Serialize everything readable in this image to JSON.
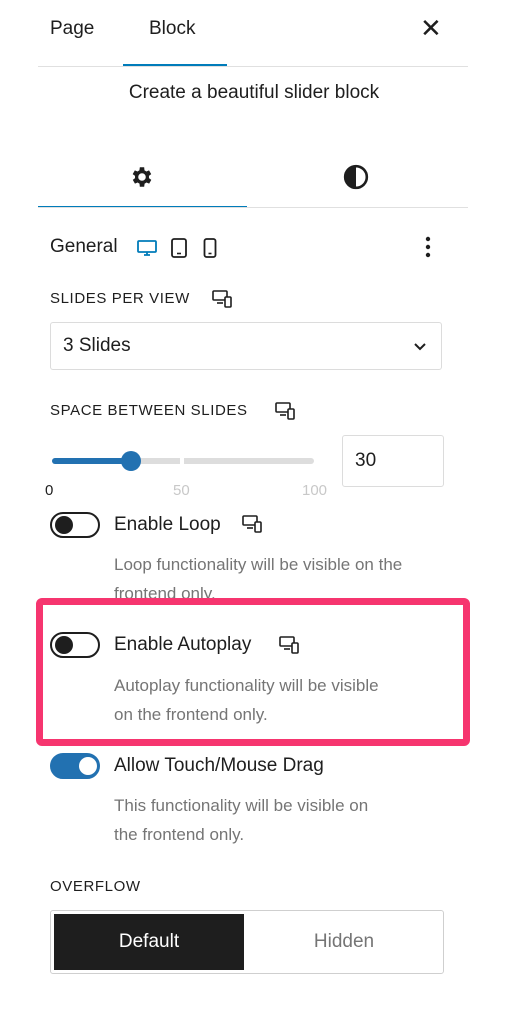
{
  "header": {
    "tabs": [
      "Page",
      "Block"
    ],
    "close_glyph": "✕",
    "icons": {
      "close": "close-icon"
    }
  },
  "block": {
    "description": "Create a beautiful slider block",
    "settings_tabs": [
      {
        "icon": "gear-icon"
      },
      {
        "icon": "contrast-icon"
      }
    ]
  },
  "general": {
    "title": "General",
    "devices": [
      "desktop-icon",
      "tablet-icon",
      "mobile-icon"
    ],
    "menu_icon": "more-vertical-icon"
  },
  "slides_per_view": {
    "label": "SLIDES PER VIEW",
    "value": "3 Slides"
  },
  "space_between": {
    "label": "SPACE BETWEEN SLIDES",
    "value": "30",
    "min": "0",
    "mid": "50",
    "max": "100",
    "fraction": 0.3
  },
  "loop": {
    "label": "Enable Loop",
    "enabled": false,
    "help": "Loop functionality will be visible on the frontend only."
  },
  "autoplay": {
    "label": "Enable Autoplay",
    "enabled": false,
    "help_line1": "Autoplay functionality will be visible",
    "help_line2": "on the frontend only."
  },
  "drag": {
    "label": "Allow Touch/Mouse Drag",
    "enabled": true,
    "help_line1": "This functionality will be visible on",
    "help_line2": "the frontend only."
  },
  "overflow": {
    "label": "OVERFLOW",
    "options": [
      "Default",
      "Hidden"
    ],
    "selected": "Default"
  },
  "colors": {
    "accent": "#007cba",
    "toggle_on": "#2271b1",
    "highlight": "#f6356f"
  }
}
